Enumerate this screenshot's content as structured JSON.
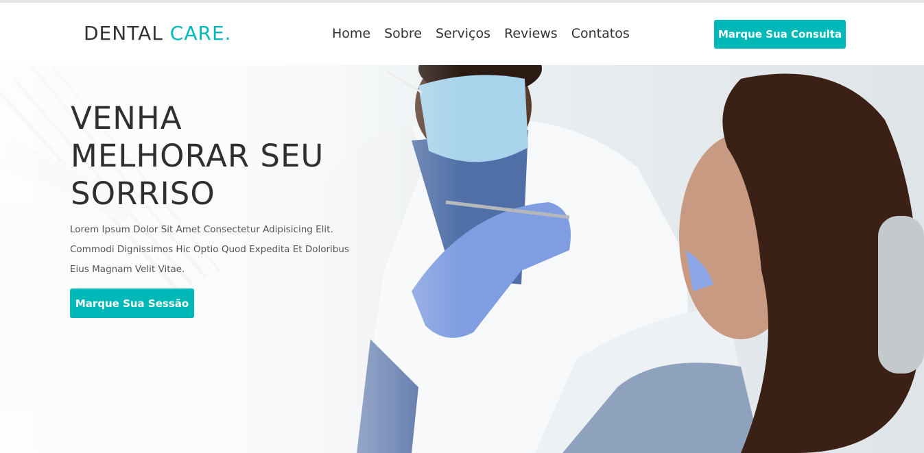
{
  "header": {
    "logo_main": "DENTAL ",
    "logo_accent": "CARE.",
    "nav": [
      "Home",
      "Sobre",
      "Serviços",
      "Reviews",
      "Contatos"
    ],
    "cta_label": "Marque Sua Consulta"
  },
  "hero": {
    "title_line1": "VENHA",
    "title_line2": "MELHORAR SEU",
    "title_line3": "SORRISO",
    "text": "Lorem Ipsum Dolor Sit Amet Consectetur Adipisicing Elit. Commodi Dignissimos Hic Optio Quod Expedita Et Doloribus Eius Magnam Velit Vitae.",
    "button_label": "Marque Sua Sessão"
  },
  "colors": {
    "accent": "#00b8b8",
    "text": "#333333"
  }
}
